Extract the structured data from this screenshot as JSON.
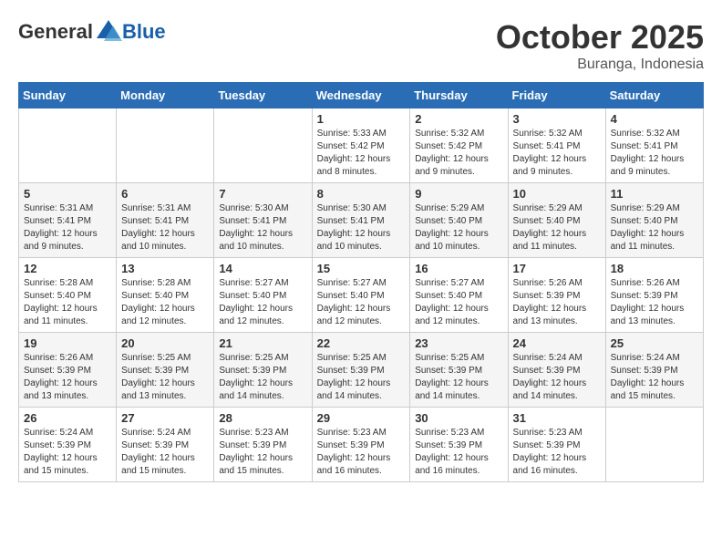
{
  "logo": {
    "general": "General",
    "blue": "Blue"
  },
  "header": {
    "month": "October 2025",
    "location": "Buranga, Indonesia"
  },
  "weekdays": [
    "Sunday",
    "Monday",
    "Tuesday",
    "Wednesday",
    "Thursday",
    "Friday",
    "Saturday"
  ],
  "weeks": [
    [
      {
        "day": "",
        "info": ""
      },
      {
        "day": "",
        "info": ""
      },
      {
        "day": "",
        "info": ""
      },
      {
        "day": "1",
        "info": "Sunrise: 5:33 AM\nSunset: 5:42 PM\nDaylight: 12 hours\nand 8 minutes."
      },
      {
        "day": "2",
        "info": "Sunrise: 5:32 AM\nSunset: 5:42 PM\nDaylight: 12 hours\nand 9 minutes."
      },
      {
        "day": "3",
        "info": "Sunrise: 5:32 AM\nSunset: 5:41 PM\nDaylight: 12 hours\nand 9 minutes."
      },
      {
        "day": "4",
        "info": "Sunrise: 5:32 AM\nSunset: 5:41 PM\nDaylight: 12 hours\nand 9 minutes."
      }
    ],
    [
      {
        "day": "5",
        "info": "Sunrise: 5:31 AM\nSunset: 5:41 PM\nDaylight: 12 hours\nand 9 minutes."
      },
      {
        "day": "6",
        "info": "Sunrise: 5:31 AM\nSunset: 5:41 PM\nDaylight: 12 hours\nand 10 minutes."
      },
      {
        "day": "7",
        "info": "Sunrise: 5:30 AM\nSunset: 5:41 PM\nDaylight: 12 hours\nand 10 minutes."
      },
      {
        "day": "8",
        "info": "Sunrise: 5:30 AM\nSunset: 5:41 PM\nDaylight: 12 hours\nand 10 minutes."
      },
      {
        "day": "9",
        "info": "Sunrise: 5:29 AM\nSunset: 5:40 PM\nDaylight: 12 hours\nand 10 minutes."
      },
      {
        "day": "10",
        "info": "Sunrise: 5:29 AM\nSunset: 5:40 PM\nDaylight: 12 hours\nand 11 minutes."
      },
      {
        "day": "11",
        "info": "Sunrise: 5:29 AM\nSunset: 5:40 PM\nDaylight: 12 hours\nand 11 minutes."
      }
    ],
    [
      {
        "day": "12",
        "info": "Sunrise: 5:28 AM\nSunset: 5:40 PM\nDaylight: 12 hours\nand 11 minutes."
      },
      {
        "day": "13",
        "info": "Sunrise: 5:28 AM\nSunset: 5:40 PM\nDaylight: 12 hours\nand 12 minutes."
      },
      {
        "day": "14",
        "info": "Sunrise: 5:27 AM\nSunset: 5:40 PM\nDaylight: 12 hours\nand 12 minutes."
      },
      {
        "day": "15",
        "info": "Sunrise: 5:27 AM\nSunset: 5:40 PM\nDaylight: 12 hours\nand 12 minutes."
      },
      {
        "day": "16",
        "info": "Sunrise: 5:27 AM\nSunset: 5:40 PM\nDaylight: 12 hours\nand 12 minutes."
      },
      {
        "day": "17",
        "info": "Sunrise: 5:26 AM\nSunset: 5:39 PM\nDaylight: 12 hours\nand 13 minutes."
      },
      {
        "day": "18",
        "info": "Sunrise: 5:26 AM\nSunset: 5:39 PM\nDaylight: 12 hours\nand 13 minutes."
      }
    ],
    [
      {
        "day": "19",
        "info": "Sunrise: 5:26 AM\nSunset: 5:39 PM\nDaylight: 12 hours\nand 13 minutes."
      },
      {
        "day": "20",
        "info": "Sunrise: 5:25 AM\nSunset: 5:39 PM\nDaylight: 12 hours\nand 13 minutes."
      },
      {
        "day": "21",
        "info": "Sunrise: 5:25 AM\nSunset: 5:39 PM\nDaylight: 12 hours\nand 14 minutes."
      },
      {
        "day": "22",
        "info": "Sunrise: 5:25 AM\nSunset: 5:39 PM\nDaylight: 12 hours\nand 14 minutes."
      },
      {
        "day": "23",
        "info": "Sunrise: 5:25 AM\nSunset: 5:39 PM\nDaylight: 12 hours\nand 14 minutes."
      },
      {
        "day": "24",
        "info": "Sunrise: 5:24 AM\nSunset: 5:39 PM\nDaylight: 12 hours\nand 14 minutes."
      },
      {
        "day": "25",
        "info": "Sunrise: 5:24 AM\nSunset: 5:39 PM\nDaylight: 12 hours\nand 15 minutes."
      }
    ],
    [
      {
        "day": "26",
        "info": "Sunrise: 5:24 AM\nSunset: 5:39 PM\nDaylight: 12 hours\nand 15 minutes."
      },
      {
        "day": "27",
        "info": "Sunrise: 5:24 AM\nSunset: 5:39 PM\nDaylight: 12 hours\nand 15 minutes."
      },
      {
        "day": "28",
        "info": "Sunrise: 5:23 AM\nSunset: 5:39 PM\nDaylight: 12 hours\nand 15 minutes."
      },
      {
        "day": "29",
        "info": "Sunrise: 5:23 AM\nSunset: 5:39 PM\nDaylight: 12 hours\nand 16 minutes."
      },
      {
        "day": "30",
        "info": "Sunrise: 5:23 AM\nSunset: 5:39 PM\nDaylight: 12 hours\nand 16 minutes."
      },
      {
        "day": "31",
        "info": "Sunrise: 5:23 AM\nSunset: 5:39 PM\nDaylight: 12 hours\nand 16 minutes."
      },
      {
        "day": "",
        "info": ""
      }
    ]
  ]
}
